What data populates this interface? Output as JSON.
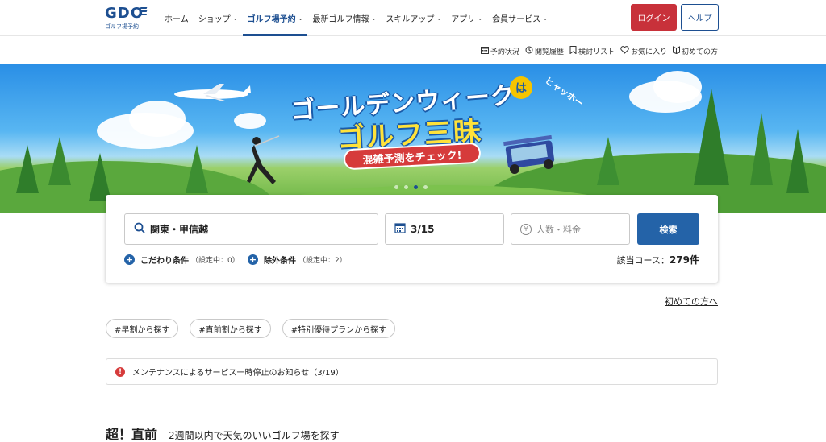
{
  "logo": {
    "text": "GDO",
    "sub": "ゴルフ場予約"
  },
  "nav": [
    {
      "label": "ホーム",
      "chevron": false,
      "active": false
    },
    {
      "label": "ショップ",
      "chevron": true,
      "active": false
    },
    {
      "label": "ゴルフ場予約",
      "chevron": true,
      "active": true
    },
    {
      "label": "最新ゴルフ情報",
      "chevron": true,
      "active": false
    },
    {
      "label": "スキルアップ",
      "chevron": true,
      "active": false
    },
    {
      "label": "アプリ",
      "chevron": true,
      "active": false
    },
    {
      "label": "会員サービス",
      "chevron": true,
      "active": false
    }
  ],
  "header": {
    "login": "ログイン",
    "help": "ヘルプ"
  },
  "subbar": [
    {
      "icon": "calendar-icon",
      "label": "予約状況"
    },
    {
      "icon": "history-icon",
      "label": "閲覧履歴"
    },
    {
      "icon": "bookmark-icon",
      "label": "検討リスト"
    },
    {
      "icon": "heart-icon",
      "label": "お気に入り"
    },
    {
      "icon": "guide-icon",
      "label": "初めての方"
    }
  ],
  "banner": {
    "title1": "ゴールデンウィーク",
    "ha": "は",
    "title2": "ゴルフ三昧",
    "pill": "混雑予測をチェック!",
    "side": "ヒャッホー"
  },
  "search": {
    "area": "関東・甲信越",
    "date": "3/15",
    "people_placeholder": "人数・料金",
    "button": "検索",
    "cond1_label": "こだわり条件",
    "cond1_status": "（設定中：0）",
    "cond2_label": "除外条件",
    "cond2_status": "（設定中：2）",
    "count_label": "該当コース：",
    "count_value": "279件"
  },
  "first_link": "初めての方へ",
  "tags": [
    "#早割から探す",
    "#直前割から探す",
    "#特別優待プランから探す"
  ],
  "notice": "メンテナンスによるサービス一時停止のお知らせ（3/19）",
  "section": {
    "title": "超！直前",
    "sub": "2週間以内で天気のいいゴルフ場を探す"
  },
  "colors": {
    "brand": "#1d4f91",
    "login": "#c8313a",
    "search_button": "#2463a8",
    "warning": "#d63b3b"
  }
}
